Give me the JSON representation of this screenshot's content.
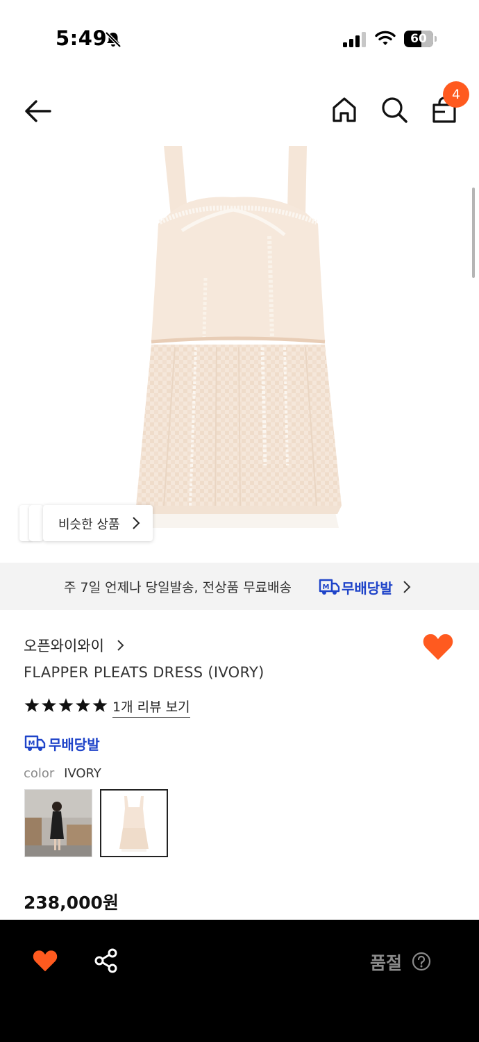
{
  "status_bar": {
    "time": "5:49",
    "battery": "60",
    "battery_level": 0.6
  },
  "nav": {
    "cart_count": "4"
  },
  "hero": {
    "similar_label": "비슷한 상품"
  },
  "shipping_banner": {
    "text": "주 7일 언제나 당일발송, 전상품 무료배송",
    "logo_text": "무배당발"
  },
  "product": {
    "brand": "오픈와이와이",
    "name": "FLAPPER PLEATS DRESS (IVORY)",
    "rating_stars": 5,
    "review_link": "1개 리뷰 보기",
    "badge": "무배당발",
    "color_label": "color",
    "color_value": "IVORY",
    "price": "238,000원"
  },
  "bottom_bar": {
    "soldout_label": "품절"
  },
  "colors": {
    "accent": "#ff5a1f",
    "badge_blue": "#1f44c9",
    "bottom_bar_bg": "#000000",
    "dress": "#f4e4d6"
  }
}
